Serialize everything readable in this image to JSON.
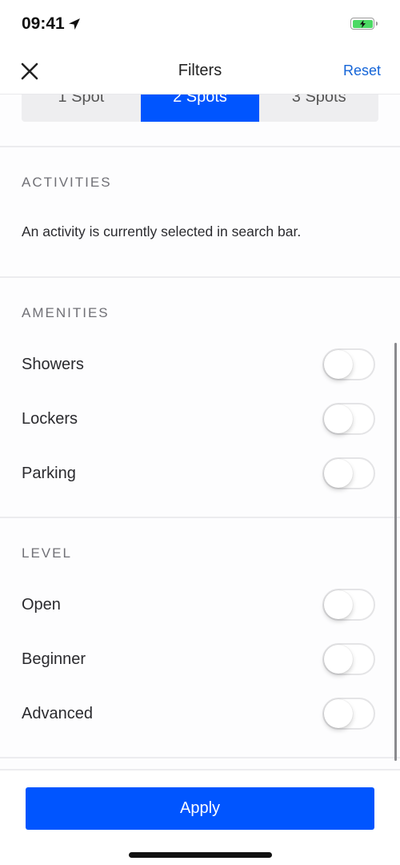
{
  "status_bar": {
    "time": "09:41"
  },
  "nav": {
    "title": "Filters",
    "reset_label": "Reset"
  },
  "spots": {
    "options": [
      "1 Spot",
      "2 Spots",
      "3 Spots"
    ],
    "selected": "2 Spots"
  },
  "activities": {
    "title": "ACTIVITIES",
    "message": "An activity is currently selected in search bar."
  },
  "amenities": {
    "title": "AMENITIES",
    "items": [
      {
        "label": "Showers",
        "on": false
      },
      {
        "label": "Lockers",
        "on": false
      },
      {
        "label": "Parking",
        "on": false
      }
    ]
  },
  "level": {
    "title": "LEVEL",
    "items": [
      {
        "label": "Open",
        "on": false
      },
      {
        "label": "Beginner",
        "on": false
      },
      {
        "label": "Advanced",
        "on": false
      }
    ]
  },
  "footer": {
    "apply_label": "Apply"
  },
  "colors": {
    "accent": "#0055ff",
    "link": "#1565d8",
    "battery": "#4cd964"
  }
}
